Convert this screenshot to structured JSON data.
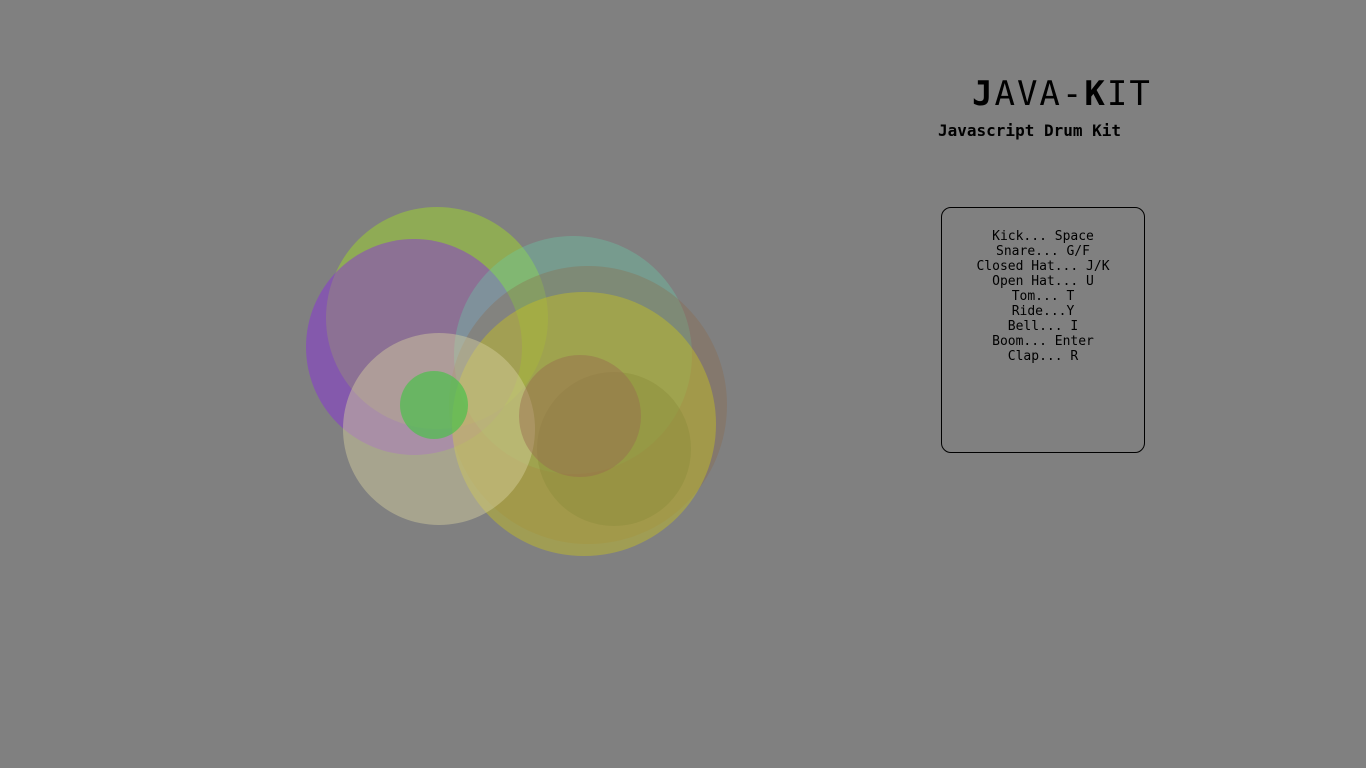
{
  "logo": {
    "first_letter": "J",
    "middle": "AVA-",
    "k_letter": "K",
    "rest": "IT"
  },
  "subtitle": "Javascript Drum Kit",
  "keymap": [
    "Kick... Space",
    "Snare... G/F",
    "Closed Hat... J/K",
    "Open Hat... U",
    "Tom... T",
    "Ride...Y",
    "Bell... I",
    "Boom... Enter",
    "Clap... R"
  ],
  "colors": {
    "background": "#808080",
    "text": "#000000"
  },
  "visualizer_circles": [
    {
      "name": "lime-circle",
      "color": "#9acd32",
      "opacity": 0.55
    },
    {
      "name": "purple-circle",
      "color": "#8a2be2",
      "opacity": 0.45
    },
    {
      "name": "teal-circle",
      "color": "#66cdaa",
      "opacity": 0.35
    },
    {
      "name": "brown-circle",
      "color": "#8b6a4a",
      "opacity": 0.35
    },
    {
      "name": "olive-circle",
      "color": "#c8c020",
      "opacity": 0.45
    },
    {
      "name": "beige-circle",
      "color": "#d8d0a0",
      "opacity": 0.45
    },
    {
      "name": "dark-olive-circle",
      "color": "#8a8a3a",
      "opacity": 0.4
    },
    {
      "name": "rust-circle",
      "color": "#9a6a50",
      "opacity": 0.45
    },
    {
      "name": "green-circle",
      "color": "#4cc04c",
      "opacity": 0.7
    }
  ]
}
